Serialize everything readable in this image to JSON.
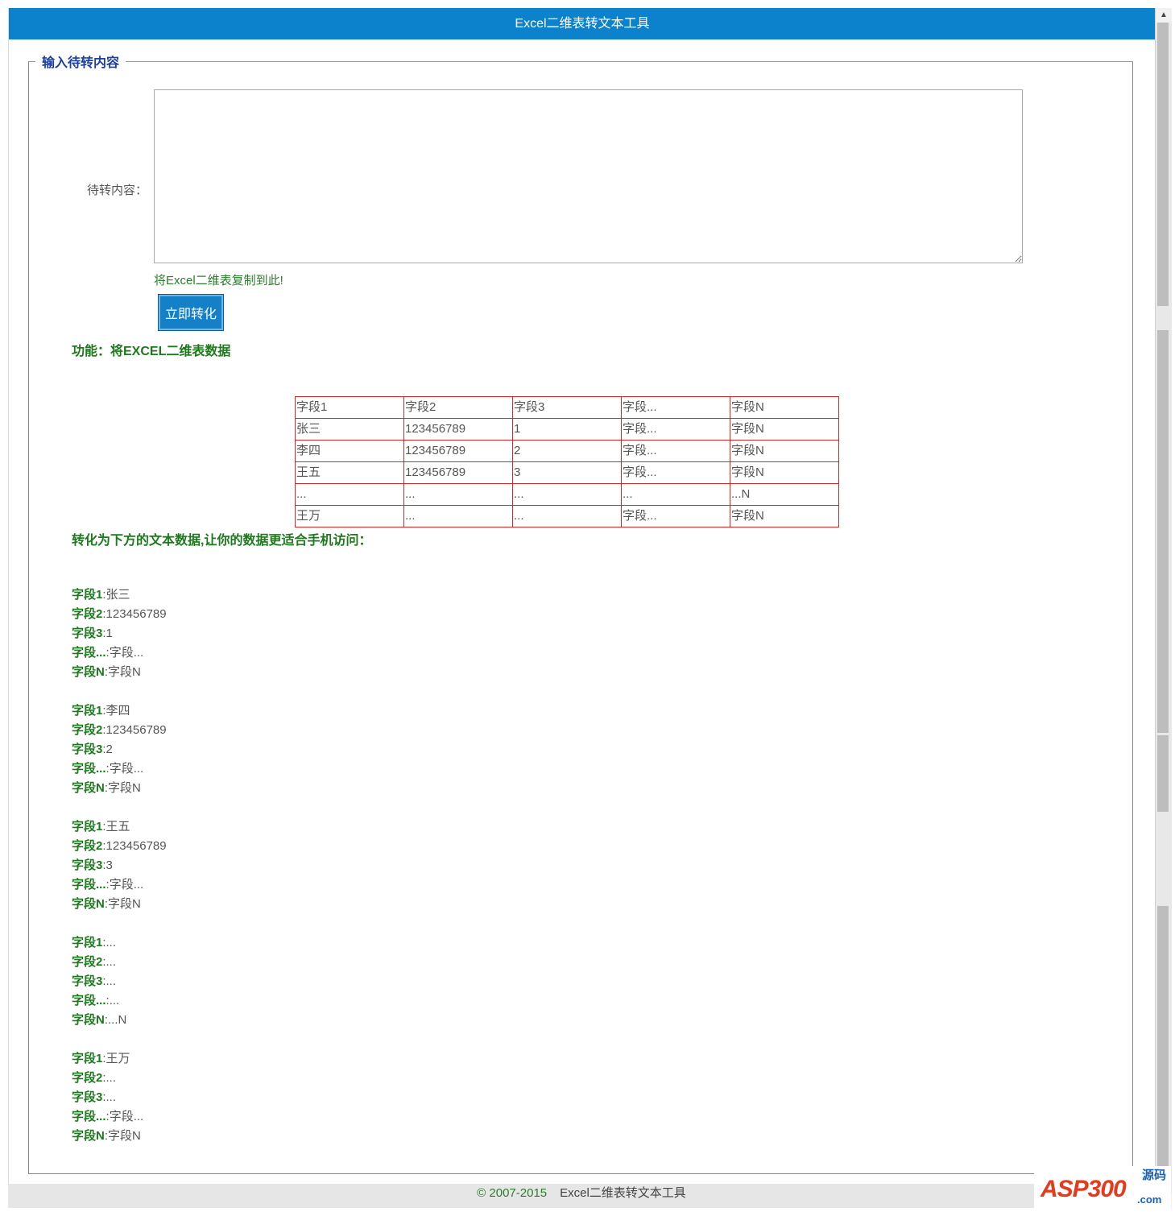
{
  "window": {
    "title": "Excel二维表转文本工具"
  },
  "form": {
    "legend": "输入待转内容",
    "input_label": "待转内容：",
    "input_value": "",
    "input_hint": "将Excel二维表复制到此!",
    "convert_button": "立即转化"
  },
  "intro": {
    "feature_text": "功能：将EXCEL二维表数据",
    "convert_text": "转化为下方的文本数据,让你的数据更适合手机访问："
  },
  "table": {
    "rows": [
      [
        "字段1",
        "字段2",
        "字段3",
        "字段...",
        "字段N"
      ],
      [
        "张三",
        "123456789",
        "1",
        "字段...",
        "字段N"
      ],
      [
        "李四",
        "123456789",
        "2",
        "字段...",
        "字段N"
      ],
      [
        "王五",
        "123456789",
        "3",
        "字段...",
        "字段N"
      ],
      [
        "...",
        "...",
        "...",
        "...",
        "...N"
      ],
      [
        "王万",
        "...",
        "...",
        "字段...",
        "字段N"
      ]
    ]
  },
  "records": [
    {
      "fields": [
        {
          "name": "字段1",
          "sep": ":",
          "value": "张三"
        },
        {
          "name": "字段2",
          "sep": ":",
          "value": "123456789"
        },
        {
          "name": "字段3",
          "sep": ":",
          "value": "1"
        },
        {
          "name": "字段...",
          "sep": ":",
          "value": "字段..."
        },
        {
          "name": "字段N",
          "sep": ":",
          "value": "字段N"
        }
      ]
    },
    {
      "fields": [
        {
          "name": "字段1",
          "sep": ":",
          "value": "李四"
        },
        {
          "name": "字段2",
          "sep": ":",
          "value": "123456789"
        },
        {
          "name": "字段3",
          "sep": ":",
          "value": "2"
        },
        {
          "name": "字段...",
          "sep": ":",
          "value": "字段..."
        },
        {
          "name": "字段N",
          "sep": ":",
          "value": "字段N"
        }
      ]
    },
    {
      "fields": [
        {
          "name": "字段1",
          "sep": ":",
          "value": "王五"
        },
        {
          "name": "字段2",
          "sep": ":",
          "value": "123456789"
        },
        {
          "name": "字段3",
          "sep": ":",
          "value": "3"
        },
        {
          "name": "字段...",
          "sep": ":",
          "value": "字段..."
        },
        {
          "name": "字段N",
          "sep": ":",
          "value": "字段N"
        }
      ]
    },
    {
      "fields": [
        {
          "name": "字段1",
          "sep": ":",
          "value": "..."
        },
        {
          "name": "字段2",
          "sep": ":",
          "value": "..."
        },
        {
          "name": "字段3",
          "sep": ":",
          "value": "..."
        },
        {
          "name": "字段...",
          "sep": ":",
          "value": "..."
        },
        {
          "name": "字段N",
          "sep": ":",
          "value": "...N"
        }
      ]
    },
    {
      "fields": [
        {
          "name": "字段1",
          "sep": ":",
          "value": "王万"
        },
        {
          "name": "字段2",
          "sep": ":",
          "value": "..."
        },
        {
          "name": "字段3",
          "sep": ":",
          "value": "..."
        },
        {
          "name": "字段...",
          "sep": ":",
          "value": "字段..."
        },
        {
          "name": "字段N",
          "sep": ":",
          "value": "字段N"
        }
      ]
    }
  ],
  "footer": {
    "copyright": "© 2007-2015",
    "title": "Excel二维表转文本工具"
  },
  "watermark": {
    "logo": "ASP300",
    "tag": "源码",
    "domain": ".com"
  },
  "scrollbar": {
    "up_icon": "triangle-up-icon",
    "down_icon": "triangle-down-icon"
  },
  "colors": {
    "title_bar": "#0c82cd",
    "accent_green": "#1c7a1c",
    "legend_blue": "#1b3ea8",
    "table_border": "#d62828"
  }
}
